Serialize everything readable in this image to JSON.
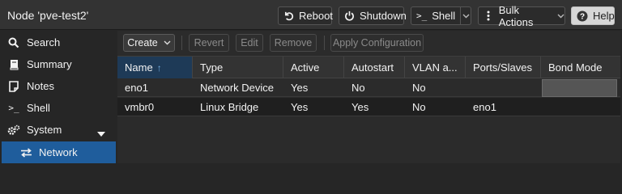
{
  "header": {
    "title": "Node 'pve-test2'",
    "buttons": {
      "reboot": "Reboot",
      "shutdown": "Shutdown",
      "shell": "Shell",
      "bulk_actions": "Bulk Actions",
      "help": "Help"
    }
  },
  "sidebar": {
    "items": [
      {
        "label": "Search",
        "icon": "search-icon"
      },
      {
        "label": "Summary",
        "icon": "book-icon"
      },
      {
        "label": "Notes",
        "icon": "notes-icon"
      },
      {
        "label": "Shell",
        "icon": "terminal-icon"
      },
      {
        "label": "System",
        "icon": "gears-icon"
      },
      {
        "label": "Network",
        "icon": "exchange-icon"
      }
    ]
  },
  "toolbar": {
    "create": "Create",
    "revert": "Revert",
    "edit": "Edit",
    "remove": "Remove",
    "apply": "Apply Configuration"
  },
  "table": {
    "columns": [
      "Name",
      "Type",
      "Active",
      "Autostart",
      "VLAN a...",
      "Ports/Slaves",
      "Bond Mode"
    ],
    "sort_indicator": "↑",
    "rows": [
      {
        "name": "eno1",
        "type": "Network Device",
        "active": "Yes",
        "autostart": "No",
        "vlan": "No",
        "ports": "",
        "bond": ""
      },
      {
        "name": "vmbr0",
        "type": "Linux Bridge",
        "active": "Yes",
        "autostart": "Yes",
        "vlan": "No",
        "ports": "eno1",
        "bond": ""
      }
    ]
  },
  "colors": {
    "accent": "#1f5d9c",
    "background": "#262626",
    "header": "#333333"
  }
}
